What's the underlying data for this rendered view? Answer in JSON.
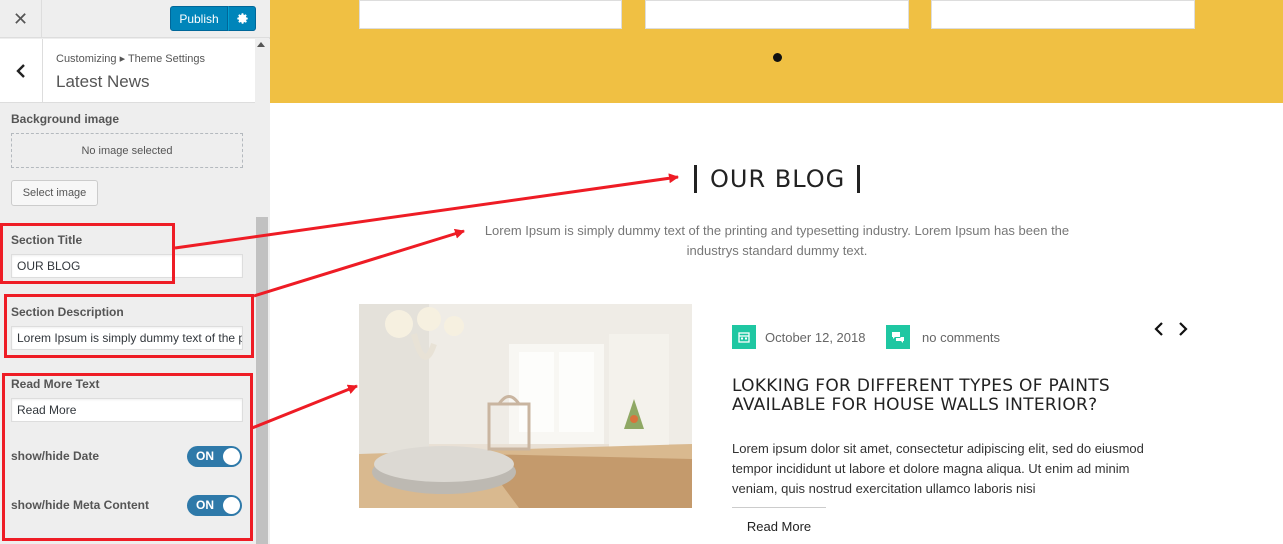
{
  "customizer": {
    "close_glyph": "✕",
    "publish_label": "Publish",
    "breadcrumb": "Customizing ▸ Theme Settings",
    "panel_title": "Latest News",
    "background_image_label": "Background image",
    "no_image_text": "No image selected",
    "select_image_label": "Select image",
    "section_title_label": "Section Title",
    "section_title_value": "OUR BLOG",
    "section_description_label": "Section Description",
    "section_description_value": "Lorem Ipsum is simply dummy text of the printing and typesetting industry.",
    "read_more_label": "Read More Text",
    "read_more_value": "Read More",
    "show_hide_date_label": "show/hide Date",
    "show_hide_date_state": "ON",
    "show_hide_meta_label": "show/hide Meta Content",
    "show_hide_meta_state": "ON"
  },
  "preview": {
    "blog_title": "OUR BLOG",
    "blog_description": "Lorem Ipsum is simply dummy text of the printing and typesetting industry. Lorem Ipsum has been the industrys standard dummy text.",
    "post": {
      "date": "October 12, 2018",
      "comments": "no comments",
      "title": "LOKKING FOR DIFFERENT TYPES OF PAINTS AVAILABLE FOR HOUSE WALLS INTERIOR?",
      "excerpt": "Lorem ipsum dolor sit amet, consectetur adipiscing elit, sed do eiusmod tempor incididunt ut labore et dolore magna aliqua. Ut enim ad minim veniam, quis nostrud exercitation ullamco laboris nisi",
      "read_more": "Read More"
    }
  },
  "colors": {
    "band": "#f0c043",
    "accent": "#1fc7a2",
    "publish": "#0085ba",
    "highlight": "#ee1c25"
  }
}
